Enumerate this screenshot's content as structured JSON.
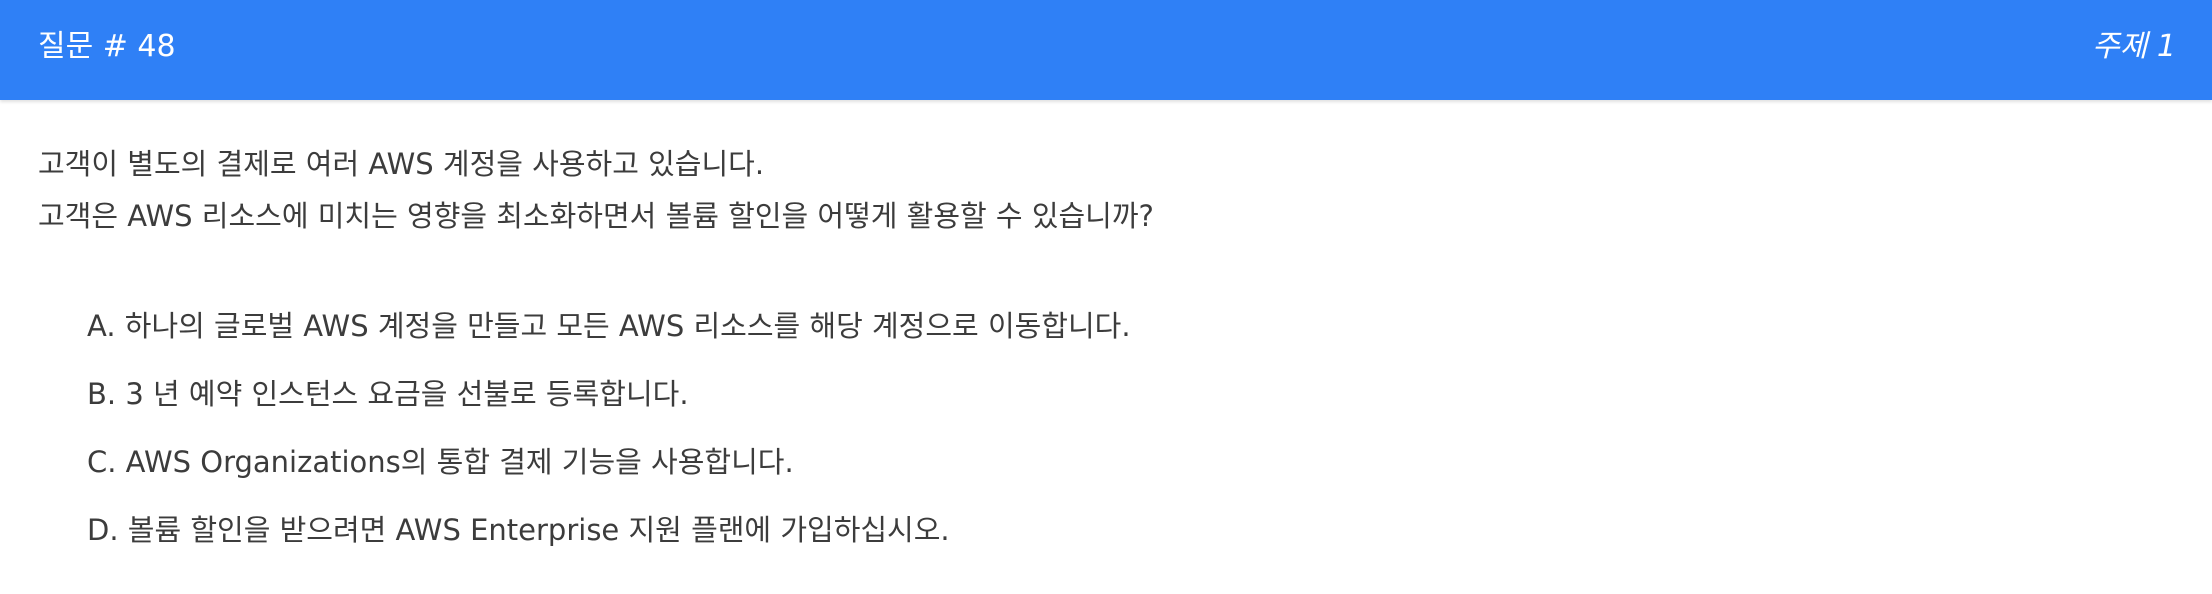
{
  "header": {
    "question_number": "질문 # 48",
    "topic": "주제 1",
    "color": "#2f80f6"
  },
  "question": {
    "lines": [
      "고객이 별도의 결제로 여러 AWS 계정을 사용하고 있습니다.",
      "고객은 AWS 리소스에 미치는 영향을 최소화하면서 볼륨 할인을 어떻게 활용할 수 있습니까?"
    ]
  },
  "choices": [
    "A. 하나의 글로벌 AWS 계정을 만들고 모든 AWS 리소스를 해당 계정으로 이동합니다.",
    "B. 3 년 예약 인스턴스 요금을 선불로 등록합니다.",
    "C. AWS Organizations의 통합 결제 기능을 사용합니다.",
    "D. 볼륨 할인을 받으려면 AWS Enterprise 지원 플랜에 가입하십시오."
  ]
}
